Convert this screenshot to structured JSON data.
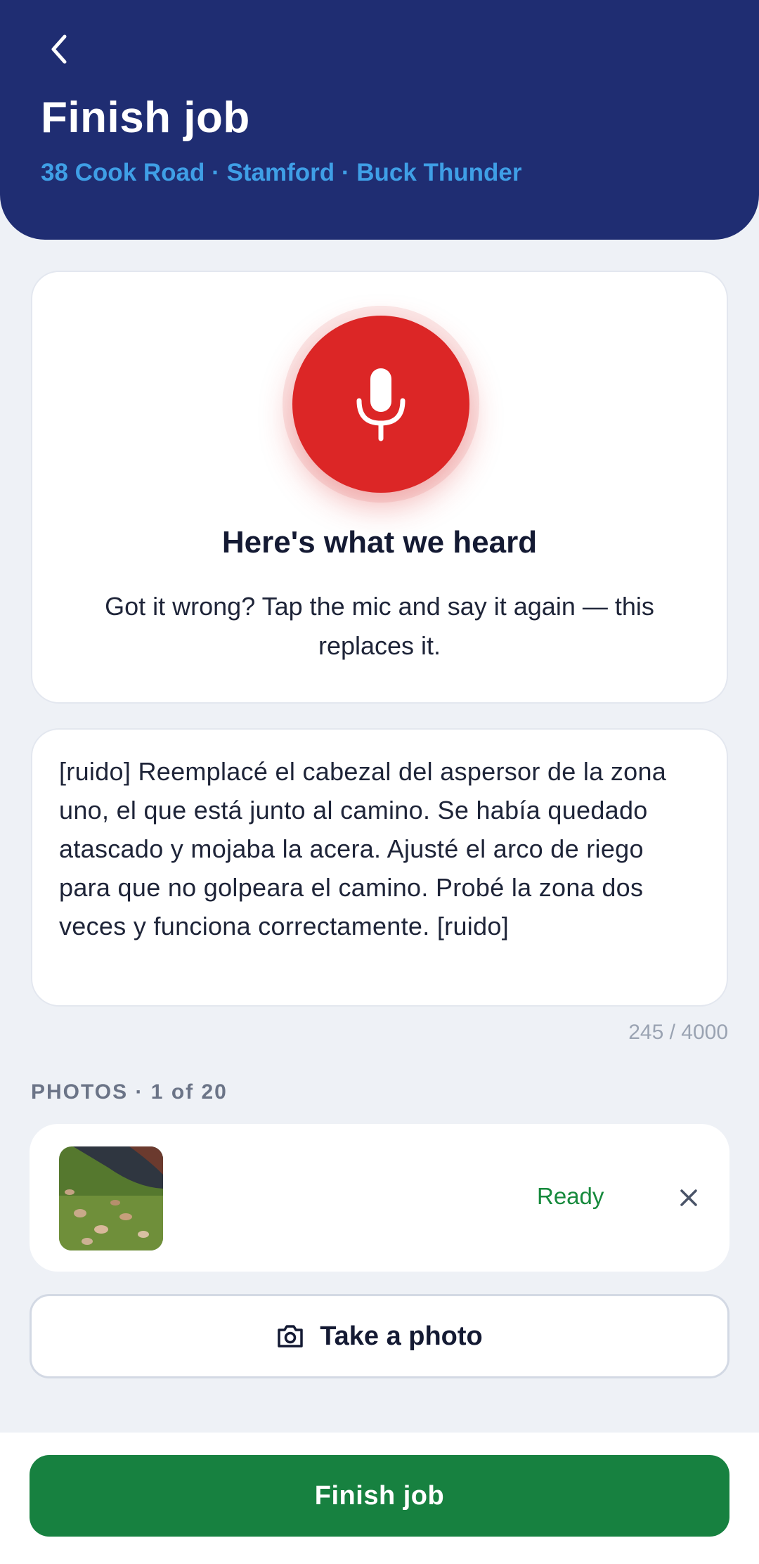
{
  "header": {
    "title": "Finish job",
    "subtitle": "38 Cook Road · Stamford · Buck Thunder",
    "back_icon": "chevron-left-icon"
  },
  "voice": {
    "mic_icon": "microphone-icon",
    "title": "Here's what we heard",
    "description": "Got it wrong? Tap the mic and say it again — this replaces it."
  },
  "transcript": {
    "text": "[ruido] Reemplacé el cabezal del aspersor de la zona uno, el que está junto al camino. Se había quedado atascado y mojaba la acera. Ajusté el arco de riego para que no golpeara el camino. Probé la zona dos veces y funciona correctamente. [ruido]",
    "char_count": "245 / 4000"
  },
  "photos": {
    "label": "PHOTOS · 1 of 20",
    "items": [
      {
        "status": "Ready",
        "remove_icon": "close-icon"
      }
    ],
    "take_photo_label": "Take a photo",
    "camera_icon": "camera-icon"
  },
  "footer": {
    "finish_label": "Finish job"
  },
  "colors": {
    "header_bg": "#1f2d72",
    "subtitle": "#3f9fe6",
    "mic": "#dc2626",
    "success": "#178a3d",
    "primary_button": "#178140"
  }
}
